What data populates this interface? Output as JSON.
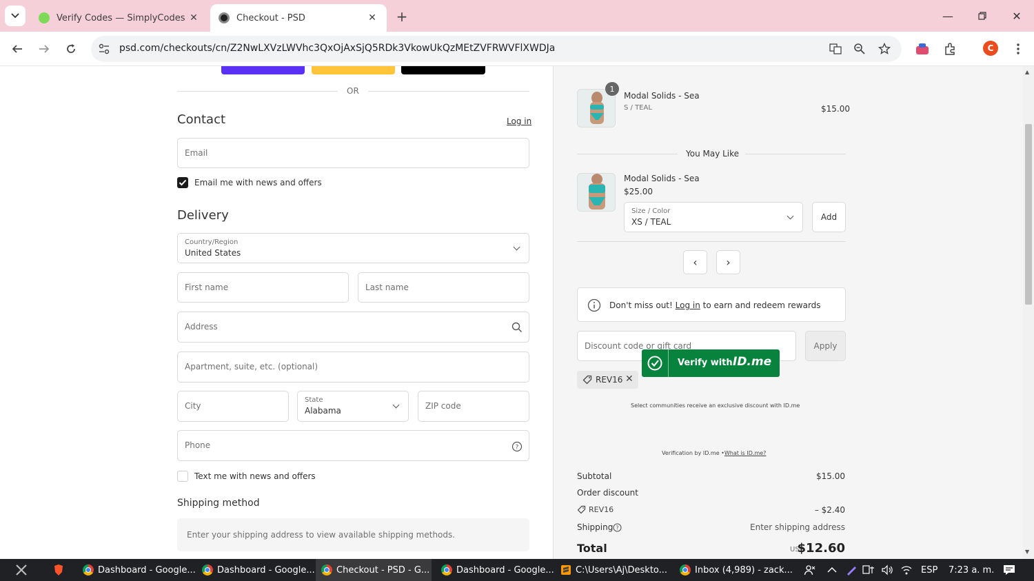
{
  "browser": {
    "tabs": [
      {
        "title": "Verify Codes — SimplyCodes",
        "active": false
      },
      {
        "title": "Checkout - PSD",
        "active": true
      }
    ],
    "url": "psd.com/checkouts/cn/Z2NwLXVzLWVhc3QxOjAxSjQ5RDk3VkowUkQzMEtZVFRWVFlXWDJa",
    "profile_initial": "C"
  },
  "checkout": {
    "or_label": "OR",
    "contact": {
      "title": "Contact",
      "login_link": "Log in",
      "email_placeholder": "Email",
      "email_opt_in": "Email me with news and offers",
      "email_opt_in_checked": true
    },
    "delivery": {
      "title": "Delivery",
      "country_label": "Country/Region",
      "country_value": "United States",
      "first_name_placeholder": "First name",
      "last_name_placeholder": "Last name",
      "address_placeholder": "Address",
      "apartment_placeholder": "Apartment, suite, etc. (optional)",
      "city_placeholder": "City",
      "state_label": "State",
      "state_value": "Alabama",
      "zip_placeholder": "ZIP code",
      "phone_placeholder": "Phone",
      "text_opt_in": "Text me with news and offers",
      "text_opt_in_checked": false
    },
    "shipping": {
      "title": "Shipping method",
      "note": "Enter your shipping address to view available shipping methods."
    }
  },
  "summary": {
    "item": {
      "name": "Modal Solids - Sea",
      "variant": "S / TEAL",
      "price": "$15.00",
      "quantity": "1"
    },
    "upsell": {
      "title": "You May Like",
      "name": "Modal Solids - Sea",
      "price": "$25.00",
      "select_label": "Size / Color",
      "select_value": "XS / TEAL",
      "add_label": "Add",
      "prev": "‹",
      "next": "›"
    },
    "rewards": {
      "prefix": "Don't miss out!",
      "login": "Log in",
      "suffix": "to earn and redeem rewards"
    },
    "discount": {
      "placeholder": "Discount code or gift card",
      "apply_label": "Apply",
      "applied_code": "REV16"
    },
    "idme": {
      "caption": "Select communities receive an exclusive discount with ID.me",
      "button_text": "Verify with",
      "logo": "ID.me",
      "footer_prefix": "Verification by ID.me •",
      "footer_link": "What is ID.me?"
    },
    "totals": {
      "subtotal_label": "Subtotal",
      "subtotal_value": "$15.00",
      "order_discount_label": "Order discount",
      "discount_code": "REV16",
      "discount_value": "– $2.40",
      "shipping_label": "Shipping",
      "shipping_value": "Enter shipping address",
      "total_label": "Total",
      "currency": "USD",
      "total_value": "$12.60"
    }
  },
  "taskbar": {
    "items": [
      {
        "label": "Dashboard - Google..."
      },
      {
        "label": "Dashboard - Google..."
      },
      {
        "label": "Checkout - PSD - G..."
      },
      {
        "label": "Dashboard - Google..."
      },
      {
        "label": "C:\\Users\\Aj\\Deskto..."
      },
      {
        "label": "Inbox (4,989) - zack..."
      }
    ],
    "lang": "ESP",
    "time": "7:23 a. m."
  },
  "colors": {
    "tabbar_bg": "#f6d0d8",
    "shop_pay": "#5a31f4",
    "paypal": "#ffc439",
    "gpay": "#000000",
    "idme_green": "#08833d",
    "profile": "#ea4c1d"
  }
}
